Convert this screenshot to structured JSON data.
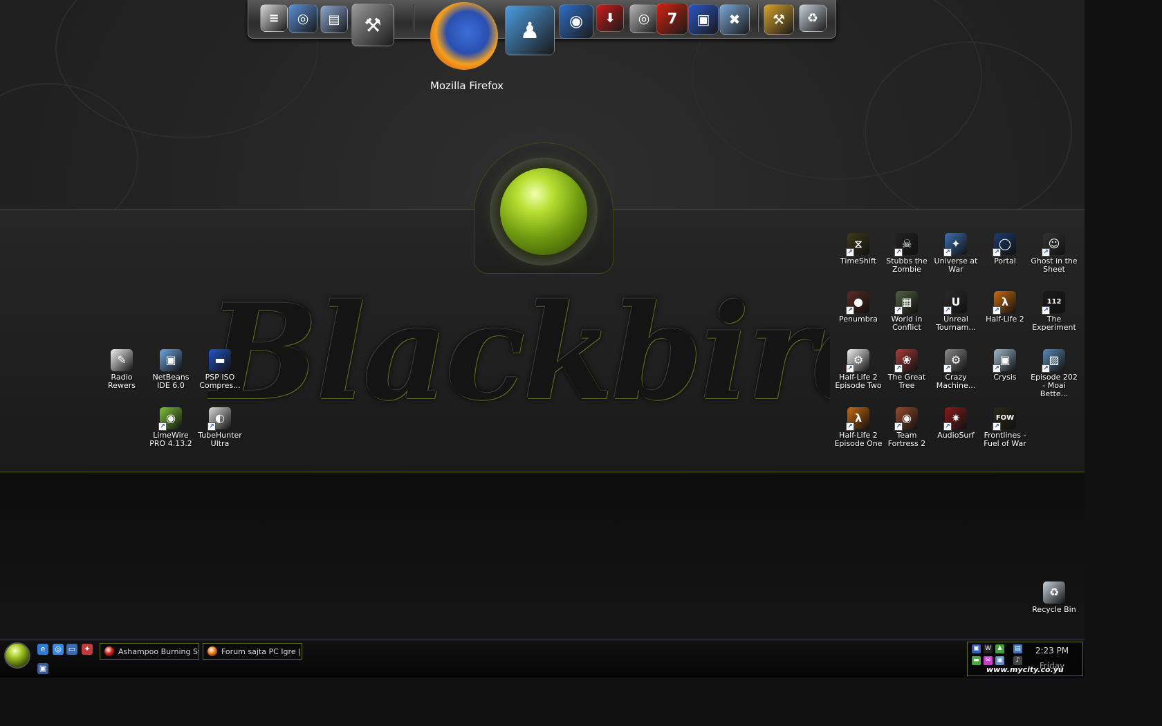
{
  "dock": {
    "items": [
      {
        "name": "document-icon",
        "symbol": "≡",
        "color": "#d9d9d9"
      },
      {
        "name": "globe-icon",
        "symbol": "◎",
        "color": "#5b8fd6"
      },
      {
        "name": "folder-icon",
        "symbol": "▤",
        "color": "#8aa8d0"
      },
      {
        "name": "system-tools-icon",
        "symbol": "⚒",
        "color": "#9a9a9a"
      },
      {
        "name": "firefox-icon",
        "symbol": "",
        "color": "#f07a10"
      },
      {
        "name": "messenger-icon",
        "symbol": "♟",
        "color": "#4c9be0"
      },
      {
        "name": "feed-icon",
        "symbol": "◉",
        "color": "#2e6fc7"
      },
      {
        "name": "download-icon",
        "symbol": "⬇",
        "color": "#cc1b1b"
      },
      {
        "name": "disc-icon",
        "symbol": "◎",
        "color": "#b5b5b5"
      },
      {
        "name": "burner-icon",
        "symbol": "7",
        "color": "#d4220f"
      },
      {
        "name": "save-disk-icon",
        "symbol": "▣",
        "color": "#2a55c5"
      },
      {
        "name": "network-icon",
        "symbol": "✖",
        "color": "#7aa8d8"
      },
      {
        "name": "tools-icon",
        "symbol": "⚒",
        "color": "#d9a42a"
      },
      {
        "name": "trash-icon",
        "symbol": "♻",
        "color": "#c9d3dc"
      }
    ],
    "tooltip": "Mozilla Firefox"
  },
  "wallpaper": {
    "brand": "Blackbird"
  },
  "desktop": {
    "left_icons": [
      {
        "name": "radio-rewers-icon",
        "label": "Radio Rewers",
        "symbol": "✎",
        "color": "#f2f2f2",
        "shortcut": false
      },
      {
        "name": "netbeans-icon",
        "label": "NetBeans IDE 6.0",
        "symbol": "▣",
        "color": "#6fa7e0",
        "shortcut": false
      },
      {
        "name": "psp-iso-icon",
        "label": "PSP ISO Compres...",
        "symbol": "▬",
        "color": "#2454c8",
        "shortcut": false
      },
      {
        "name": "limewire-icon",
        "label": "LimeWire PRO 4.13.2",
        "symbol": "◉",
        "color": "#7cc23a",
        "shortcut": true
      },
      {
        "name": "tubehunter-icon",
        "label": "TubeHunter Ultra",
        "symbol": "◐",
        "color": "#d8d8d8",
        "shortcut": true
      }
    ],
    "right_icons": [
      {
        "name": "timeshift-icon",
        "label": "TimeShift",
        "symbol": "⧖",
        "color": "#3b3b1a",
        "shortcut": true
      },
      {
        "name": "stubbs-icon",
        "label": "Stubbs the Zombie",
        "symbol": "☠",
        "color": "#222222",
        "shortcut": true
      },
      {
        "name": "universe-at-war-icon",
        "label": "Universe at War",
        "symbol": "✦",
        "color": "#3d6fb0",
        "shortcut": true
      },
      {
        "name": "portal-icon",
        "label": "Portal",
        "symbol": "◯",
        "color": "#1e3b70",
        "shortcut": true
      },
      {
        "name": "ghost-icon",
        "label": "Ghost in the Sheet",
        "symbol": "☺",
        "color": "#333333",
        "shortcut": true
      },
      {
        "name": "penumbra-icon",
        "label": "Penumbra",
        "symbol": "●",
        "color": "#5a2a22",
        "shortcut": true
      },
      {
        "name": "world-in-conflict-icon",
        "label": "World in Conflict",
        "symbol": "▦",
        "color": "#506040",
        "shortcut": true
      },
      {
        "name": "unreal-icon",
        "label": "Unreal Tournam...",
        "symbol": "U",
        "color": "#2a2a2a",
        "shortcut": true
      },
      {
        "name": "half-life-2-icon",
        "label": "Half-Life 2",
        "symbol": "λ",
        "color": "#c96a10",
        "shortcut": true
      },
      {
        "name": "the-experiment-icon",
        "label": "The Experiment",
        "symbol": "112",
        "color": "#1a1a1a",
        "shortcut": true
      },
      {
        "name": "hl2-episode-two-icon",
        "label": "Half-Life 2 Episode Two",
        "symbol": "⚙",
        "color": "#f2f2f2",
        "shortcut": true
      },
      {
        "name": "great-tree-icon",
        "label": "The Great Tree",
        "symbol": "❀",
        "color": "#a83a3a",
        "shortcut": true
      },
      {
        "name": "crazy-machines-icon",
        "label": "Crazy Machine...",
        "symbol": "⚙",
        "color": "#8a8a8a",
        "shortcut": true
      },
      {
        "name": "crysis-icon",
        "label": "Crysis",
        "symbol": "▣",
        "color": "#a0b8cc",
        "shortcut": true
      },
      {
        "name": "episode-202-icon",
        "label": "Episode 202 - Moai Bette...",
        "symbol": "▨",
        "color": "#5a8ab5",
        "shortcut": true
      },
      {
        "name": "hl2-episode-one-icon",
        "label": "Half-Life 2 Episode One",
        "symbol": "λ",
        "color": "#c96a10",
        "shortcut": true
      },
      {
        "name": "team-fortress-2-icon",
        "label": "Team Fortress 2",
        "symbol": "◉",
        "color": "#9a4a2a",
        "shortcut": true
      },
      {
        "name": "audiosurf-icon",
        "label": "AudioSurf",
        "symbol": "✷",
        "color": "#8a1a1a",
        "shortcut": true
      },
      {
        "name": "frontlines-icon",
        "label": "Frontlines - Fuel of War",
        "symbol": "FOW",
        "color": "#2a2a1a",
        "shortcut": true
      }
    ],
    "recycle_bin": {
      "name": "recycle-bin-icon",
      "label": "Recycle Bin",
      "symbol": "♻",
      "color": "#c9d3dc"
    }
  },
  "taskbar": {
    "quick_launch": [
      {
        "name": "ie-icon",
        "symbol": "e",
        "color": "#2d7ad8"
      },
      {
        "name": "quick-search-icon",
        "symbol": "◎",
        "color": "#3b8ae0"
      },
      {
        "name": "show-desktop-icon",
        "symbol": "▭",
        "color": "#3a6ab0"
      },
      {
        "name": "media-icon",
        "symbol": "✦",
        "color": "#c43a3a"
      },
      {
        "name": "extra-launch-icon",
        "symbol": "▣",
        "color": "#3a5a9a"
      }
    ],
    "tasks": [
      {
        "name": "task-ashampoo",
        "label": "Ashampoo Burning St...",
        "color": "#d4220f"
      },
      {
        "name": "task-firefox-forum",
        "label": "Forum sajta PC Igre | P...",
        "color": "#f07a10"
      }
    ],
    "tray_icons": [
      {
        "name": "tray-network-icon",
        "symbol": "▣",
        "color": "#2d5fc0"
      },
      {
        "name": "tray-winamp-icon",
        "symbol": "W",
        "color": "#222222"
      },
      {
        "name": "tray-messenger-icon",
        "symbol": "♟",
        "color": "#3da03d"
      },
      {
        "name": "tray-connection-icon",
        "symbol": "▤",
        "color": "#3a7ac8"
      },
      {
        "name": "tray-chat-icon",
        "symbol": "▬",
        "color": "#4aa83a"
      },
      {
        "name": "tray-mail-icon",
        "symbol": "✉",
        "color": "#c83ac8"
      },
      {
        "name": "tray-display-icon",
        "symbol": "▣",
        "color": "#5a8ad0"
      },
      {
        "name": "tray-volume-icon",
        "symbol": "♪",
        "color": "#444444"
      }
    ],
    "clock": "2:23 PM",
    "day": "Friday",
    "watermark": "www.mycity.co.yu"
  }
}
